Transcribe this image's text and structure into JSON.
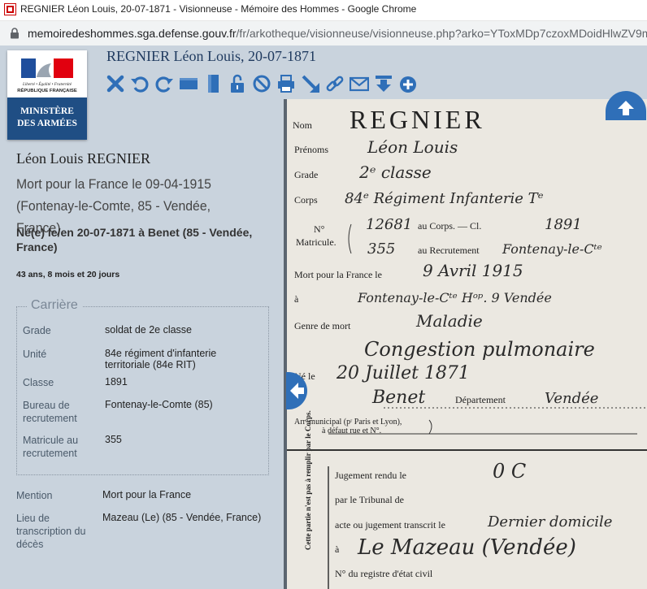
{
  "browser": {
    "window_title": "REGNIER Léon Louis, 20-07-1871 - Visionneuse - Mémoire des Hommes - Google Chrome",
    "url_host": "memoiredeshommes.sga.defense.gouv.fr",
    "url_path": "/fr/arkotheque/visionneuse/visionneuse.php?arko=YToxMDp7czoxMDoidHlwZV9m"
  },
  "header": {
    "title": "REGNIER Léon Louis, 20-07-1871",
    "tools": [
      "close-icon",
      "rotate-left-icon",
      "rotate-right-icon",
      "fit-width-icon",
      "fit-height-icon",
      "unlock-icon",
      "block-icon",
      "print-icon",
      "fullscreen-icon",
      "link-icon",
      "mail-icon",
      "download-icon",
      "add-icon"
    ]
  },
  "logo": {
    "republic_text": "Liberté • Égalité • Fraternité",
    "republic_name": "RÉPUBLIQUE FRANÇAISE",
    "ministry_line1": "MINISTÈRE",
    "ministry_line2": "DES ARMÉES"
  },
  "person": {
    "name": "Léon Louis REGNIER",
    "death": "Mort pour la France le 09-04-1915 (Fontenay-le-Comte, 85 - Vendée, France)",
    "birth": "Né(e) le/en 20-07-1871 à Benet (85 - Vendée, France)",
    "age": "43 ans, 8 mois et 20 jours"
  },
  "career": {
    "legend": "Carrière",
    "rows": [
      {
        "label": "Grade",
        "value": "soldat de 2e classe"
      },
      {
        "label": "Unité",
        "value": "84e régiment d'infanterie territoriale (84e RIT)"
      },
      {
        "label": "Classe",
        "value": "1891"
      },
      {
        "label": "Bureau de recrutement",
        "value": "Fontenay-le-Comte (85)"
      },
      {
        "label": "Matricule au recrutement",
        "value": "355"
      }
    ]
  },
  "extra": [
    {
      "label": "Mention",
      "value": "Mort pour la France"
    },
    {
      "label": "Lieu de transcription du décès",
      "value": "Mazeau (Le) (85 - Vendée, France)"
    }
  ],
  "document": {
    "header_name": "REGNIER",
    "labels": {
      "nom": "Nom",
      "prenoms": "Prénoms",
      "grade": "Grade",
      "corps": "Corps",
      "no": "N°",
      "matricule": "Matricule.",
      "au_corps": "au Corps. — Cl.",
      "au_recrutement": "au Recrutement",
      "mort_pour": "Mort pour la France le",
      "a": "à",
      "genre": "Genre de mort",
      "ne_le": "Né le",
      "a2": "à",
      "departement": "Département",
      "arr1": "Arrᵗ municipal (pʳ Paris et Lyon),",
      "arr2": "à défaut rue et N°.",
      "jugement": "Jugement rendu le",
      "tribunal": "par le Tribunal de",
      "acte": "acte ou jugement transcrit le",
      "a3": "à",
      "registre": "N° du registre d'état civil",
      "side": "Cette partie n'est pas à remplir par le Corps."
    },
    "handwritten": {
      "prenoms": "Léon Louis",
      "grade": "2ᵉ classe",
      "corps": "84ᵉ Régiment Infanterie Tᵉ",
      "no_corps": "12681",
      "classe": "1891",
      "no_recrutement": "355",
      "recrutement": "Fontenay-le-Cᵗᵉ",
      "date_mort": "9 Avril 1915",
      "lieu_mort": "Fontenay-le-Cᵗᵉ Hᵒᵖ. 9 Vendée",
      "genre1": "Maladie",
      "genre2": "Congestion pulmonaire",
      "date_naissance": "20 Juillet 1871",
      "lieu_naissance": "Benet",
      "departement": "Vendée",
      "jugement": "0 C",
      "acte": "Dernier domicile",
      "lieu_acte": "Le Mazeau (Vendée)"
    }
  }
}
